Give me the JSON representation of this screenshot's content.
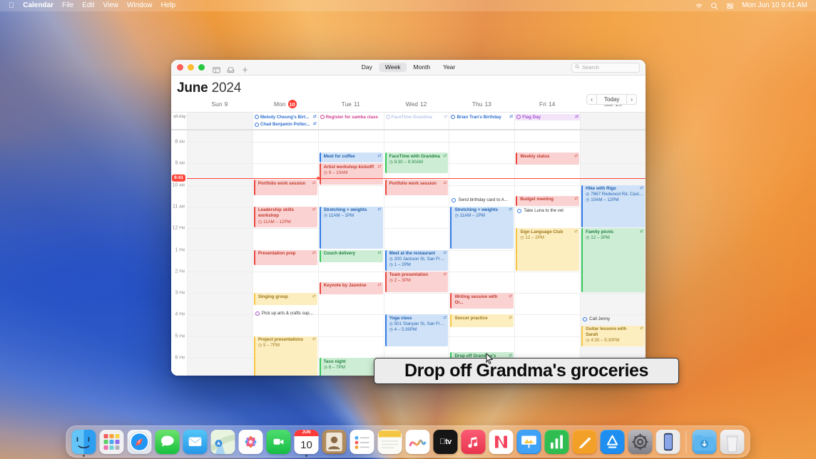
{
  "menubar": {
    "apple": "",
    "items": [
      "Calendar",
      "File",
      "Edit",
      "View",
      "Window",
      "Help"
    ],
    "status_icons": [
      "wifi-icon",
      "search-icon",
      "control-center-icon"
    ],
    "clock": "Mon Jun 10  9:41 AM"
  },
  "window": {
    "traffic_lights": [
      "close-button",
      "minimize-button",
      "zoom-button"
    ],
    "toolbar_icons": [
      "calendar-view-icon",
      "inbox-icon",
      "add-event-icon"
    ],
    "view_segments": [
      "Day",
      "Week",
      "Month",
      "Year"
    ],
    "view_selected": "Week",
    "search": {
      "placeholder": "Search",
      "value": ""
    },
    "month": "June",
    "year": "2024",
    "nav": {
      "prev": "‹",
      "today": "Today",
      "next": "›"
    },
    "allday_label": "all-day"
  },
  "days": [
    {
      "dow": "Sun",
      "num": "9",
      "today": false,
      "shade": true
    },
    {
      "dow": "Mon",
      "num": "10",
      "today": true,
      "shade": false
    },
    {
      "dow": "Tue",
      "num": "11",
      "today": false,
      "shade": false
    },
    {
      "dow": "Wed",
      "num": "12",
      "today": false,
      "shade": false
    },
    {
      "dow": "Thu",
      "num": "13",
      "today": false,
      "shade": false
    },
    {
      "dow": "Fri",
      "num": "14",
      "today": false,
      "shade": false
    },
    {
      "dow": "Sat",
      "num": "15",
      "today": false,
      "shade": true
    }
  ],
  "hours": [
    {
      "label": "8",
      "ap": "AM"
    },
    {
      "label": "9",
      "ap": "AM"
    },
    {
      "label": "10",
      "ap": "AM"
    },
    {
      "label": "11",
      "ap": "AM"
    },
    {
      "label": "12",
      "ap": "PM"
    },
    {
      "label": "1",
      "ap": "PM"
    },
    {
      "label": "2",
      "ap": "PM"
    },
    {
      "label": "3",
      "ap": "PM"
    },
    {
      "label": "4",
      "ap": "PM"
    },
    {
      "label": "5",
      "ap": "PM"
    },
    {
      "label": "6",
      "ap": "PM"
    }
  ],
  "now": {
    "label": "9:41",
    "day_index": 1
  },
  "allday_events": [
    {
      "day": 1,
      "title": "Melody Cheung's Birt...",
      "color": "blue",
      "recurring": true,
      "type": "birthday"
    },
    {
      "day": 1,
      "title": "Chad Benjamin Potter...",
      "color": "blue",
      "recurring": true,
      "type": "birthday"
    },
    {
      "day": 2,
      "title": "Register for samba class",
      "color": "pink",
      "recurring": false,
      "type": "task"
    },
    {
      "day": 3,
      "title": "FaceTime Grandma",
      "color": "faded",
      "recurring": true,
      "type": "task"
    },
    {
      "day": 4,
      "title": "Brian Tran's Birthday",
      "color": "blue",
      "recurring": true,
      "type": "birthday"
    },
    {
      "day": 5,
      "title": "Flag Day",
      "color": "purple",
      "recurring": true,
      "type": "holiday"
    }
  ],
  "events": [
    {
      "day": 1,
      "title": "Portfolio work session",
      "meta": "",
      "color": "c-red",
      "start": 9.75,
      "end": 10.5,
      "recurring": true
    },
    {
      "day": 1,
      "title": "Leadership skills workshop",
      "meta": "11AM – 12PM",
      "color": "c-red",
      "start": 11.0,
      "end": 12.0,
      "recurring": true
    },
    {
      "day": 1,
      "title": "Presentation prep",
      "meta": "",
      "color": "c-red",
      "start": 13.0,
      "end": 13.75,
      "recurring": true
    },
    {
      "day": 1,
      "title": "Singing group",
      "meta": "",
      "color": "c-yellow",
      "start": 15.0,
      "end": 15.6,
      "recurring": true
    },
    {
      "day": 1,
      "title": "Pick up arts & crafts sup...",
      "meta": "",
      "color": "task-purple",
      "start": 15.75,
      "end": 16.2,
      "recurring": false
    },
    {
      "day": 1,
      "title": "Project presentations",
      "meta": "5 – 7PM",
      "color": "c-yellow",
      "start": 17.0,
      "end": 19.0,
      "recurring": true
    },
    {
      "day": 2,
      "title": "Meet for coffee",
      "meta": "",
      "color": "c-blue",
      "start": 8.5,
      "end": 9.0,
      "recurring": true
    },
    {
      "day": 2,
      "title": "Artist workshop kickoff!",
      "meta": "9 – 10AM",
      "color": "c-red",
      "start": 9.0,
      "end": 10.0,
      "recurring": true
    },
    {
      "day": 2,
      "title": "Stretching + weights",
      "meta": "11AM – 1PM",
      "color": "c-blue",
      "start": 11.0,
      "end": 13.0,
      "recurring": true
    },
    {
      "day": 2,
      "title": "Couch delivery",
      "meta": "",
      "color": "c-green",
      "start": 13.0,
      "end": 13.6,
      "recurring": true
    },
    {
      "day": 2,
      "title": "Keynote by Jasmine",
      "meta": "",
      "color": "c-red",
      "start": 14.5,
      "end": 15.1,
      "recurring": true
    },
    {
      "day": 2,
      "title": "Taco night",
      "meta": "6 – 7PM",
      "color": "c-green",
      "start": 18.0,
      "end": 19.0,
      "recurring": false
    },
    {
      "day": 3,
      "title": "FaceTime with Grandma",
      "meta": "8:30 – 9:30AM",
      "color": "c-green",
      "start": 8.5,
      "end": 9.5,
      "recurring": true
    },
    {
      "day": 3,
      "title": "Portfolio work session",
      "meta": "",
      "color": "c-red",
      "start": 9.75,
      "end": 10.5,
      "recurring": true
    },
    {
      "day": 3,
      "title": "Meet at the restaurant",
      "meta": "200 Jackson St, San Fran... | 1 – 2PM",
      "color": "c-blue",
      "start": 13.0,
      "end": 14.0,
      "recurring": true
    },
    {
      "day": 3,
      "title": "Team presentation",
      "meta": "2 – 3PM",
      "color": "c-red",
      "start": 14.0,
      "end": 15.0,
      "recurring": true
    },
    {
      "day": 3,
      "title": "Yoga class",
      "meta": "501 Stanyan St, San Fran... | 4 – 5:30PM",
      "color": "c-blue",
      "start": 16.0,
      "end": 17.5,
      "recurring": true
    },
    {
      "day": 4,
      "title": "Send birthday card to A...",
      "meta": "",
      "color": "task-blue",
      "start": 10.5,
      "end": 10.95,
      "recurring": false
    },
    {
      "day": 4,
      "title": "Stretching + weights",
      "meta": "11AM – 1PM",
      "color": "c-blue",
      "start": 11.0,
      "end": 13.0,
      "recurring": true
    },
    {
      "day": 4,
      "title": "Writing session with Or...",
      "meta": "",
      "color": "c-red",
      "start": 15.0,
      "end": 15.75,
      "recurring": true
    },
    {
      "day": 4,
      "title": "Soccer practice",
      "meta": "",
      "color": "c-yellow",
      "start": 16.0,
      "end": 16.6,
      "recurring": true
    },
    {
      "day": 4,
      "title": "Drop off Grandma's groceries",
      "meta": "",
      "color": "c-green",
      "start": 17.75,
      "end": 18.7,
      "recurring": true
    },
    {
      "day": 5,
      "title": "Weekly status",
      "meta": "",
      "color": "c-red",
      "start": 8.5,
      "end": 9.1,
      "recurring": true
    },
    {
      "day": 5,
      "title": "Budget meeting",
      "meta": "",
      "color": "c-red",
      "start": 10.5,
      "end": 11.0,
      "recurring": true
    },
    {
      "day": 5,
      "title": "Take Luna to the vet",
      "meta": "",
      "color": "task-blue",
      "start": 11.0,
      "end": 11.45,
      "recurring": false
    },
    {
      "day": 5,
      "title": "Sign Language Club",
      "meta": "12 – 2PM",
      "color": "c-yellow",
      "start": 12.0,
      "end": 14.0,
      "recurring": true
    },
    {
      "day": 6,
      "title": "Hike with Rigo",
      "meta": "7867 Redwood Rd, Castr... | 10AM – 12PM",
      "color": "c-blue",
      "start": 10.0,
      "end": 12.0,
      "recurring": true
    },
    {
      "day": 6,
      "title": "Family picnic",
      "meta": "12 – 3PM",
      "color": "c-green",
      "start": 12.0,
      "end": 15.0,
      "recurring": true
    },
    {
      "day": 6,
      "title": "Call Jenny",
      "meta": "",
      "color": "task-blue",
      "start": 16.0,
      "end": 16.45,
      "recurring": false
    },
    {
      "day": 6,
      "title": "Guitar lessons with Sarah",
      "meta": "4:30 – 5:30PM",
      "color": "c-yellow",
      "start": 16.5,
      "end": 17.5,
      "recurring": true
    }
  ],
  "tooltip": {
    "text": "Drop off Grandma's groceries"
  },
  "dock": {
    "items": [
      {
        "name": "finder",
        "glyph": "◑",
        "bg": "linear-gradient(#3ab6f5,#1b8ae0)",
        "running": true
      },
      {
        "name": "launchpad",
        "glyph": "",
        "bg": "#f1f1f3",
        "running": false
      },
      {
        "name": "safari",
        "glyph": "",
        "bg": "linear-gradient(#f4f7fa,#dfe6ee)",
        "running": false
      },
      {
        "name": "messages",
        "glyph": "●",
        "bg": "linear-gradient(#6ce36b,#17c13e)",
        "running": false
      },
      {
        "name": "mail",
        "glyph": "✉",
        "bg": "linear-gradient(#52c6f8,#2596e8)",
        "running": false
      },
      {
        "name": "maps",
        "glyph": "",
        "bg": "linear-gradient(#eaf3dd,#cfe3c7)",
        "running": false
      },
      {
        "name": "photos",
        "glyph": "",
        "bg": "#fdfdfd",
        "running": false
      },
      {
        "name": "facetime",
        "glyph": "▶",
        "bg": "linear-gradient(#4edc6f,#16bd45)",
        "running": false
      },
      {
        "name": "calendar",
        "glyph": "",
        "bg": "#ffffff",
        "running": true
      },
      {
        "name": "contacts",
        "glyph": "",
        "bg": "linear-gradient(#c79a63,#9c7344)",
        "running": false
      },
      {
        "name": "reminders",
        "glyph": "",
        "bg": "#fdfdfd",
        "running": false
      },
      {
        "name": "notes",
        "glyph": "",
        "bg": "#fdfdfd",
        "running": false
      },
      {
        "name": "freeform",
        "glyph": "∿",
        "bg": "#ffffff",
        "running": false
      },
      {
        "name": "apple-tv",
        "glyph": "tv",
        "bg": "#161616",
        "running": false
      },
      {
        "name": "music",
        "glyph": "♫",
        "bg": "linear-gradient(#fb5c74,#e8344e)",
        "running": false
      },
      {
        "name": "news",
        "glyph": "N",
        "bg": "#ffffff",
        "running": false
      },
      {
        "name": "keynote",
        "glyph": "",
        "bg": "linear-gradient(#3fa2f7,#1f7ee0)",
        "running": false
      },
      {
        "name": "numbers",
        "glyph": "",
        "bg": "linear-gradient(#55d76a,#23b84a)",
        "running": false
      },
      {
        "name": "pages",
        "glyph": "╱",
        "bg": "linear-gradient(#ffb648,#f09020)",
        "running": false
      },
      {
        "name": "app-store",
        "glyph": "A",
        "bg": "linear-gradient(#3fa9f5,#1478e0)",
        "running": false
      },
      {
        "name": "system-settings",
        "glyph": "⚙",
        "bg": "linear-gradient(#b9b9bd,#7d7d85)",
        "running": false
      },
      {
        "name": "iphone-mirroring",
        "glyph": "",
        "bg": "linear-gradient(#f2f2f4,#d8d8dc)",
        "running": false
      }
    ],
    "trailing": [
      {
        "name": "downloads-folder",
        "glyph": "↓",
        "bg": "linear-gradient(#7fc6f2,#4aa6e8)"
      },
      {
        "name": "trash",
        "glyph": "",
        "bg": "linear-gradient(#f3f3f5,#dcdcdf)"
      }
    ]
  }
}
